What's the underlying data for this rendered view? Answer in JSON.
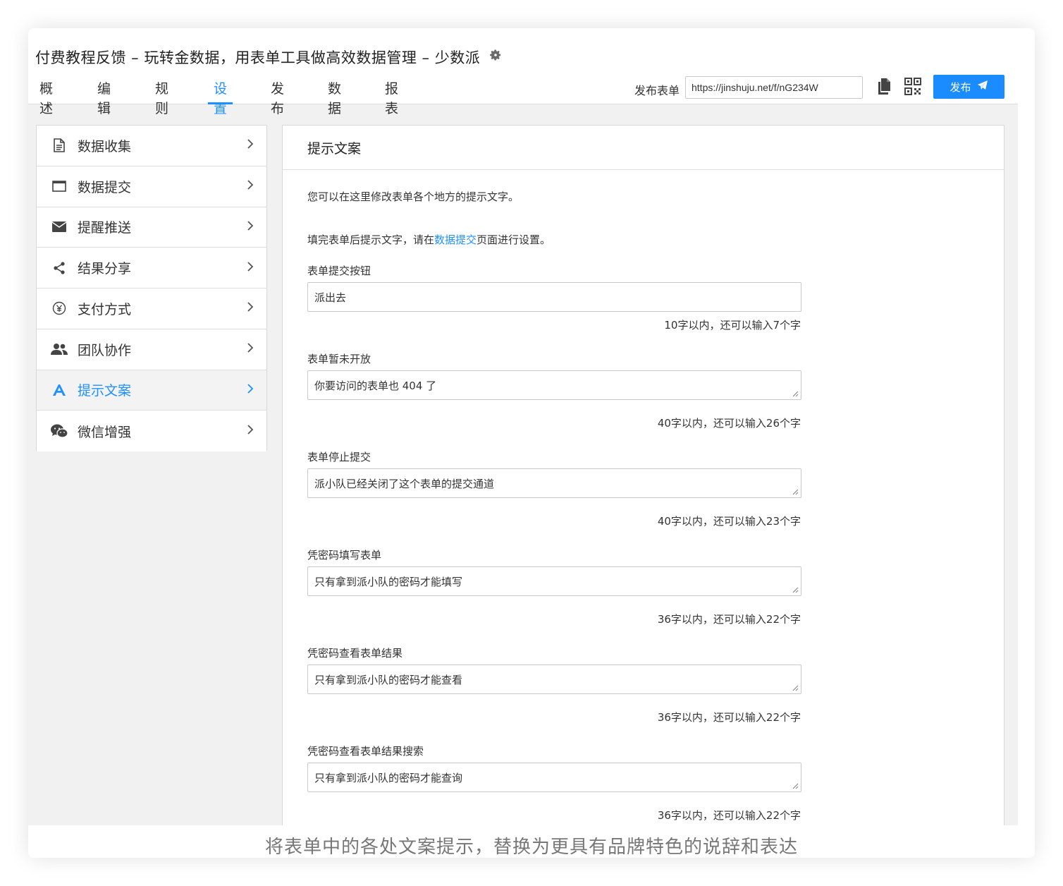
{
  "header": {
    "title": "付费教程反馈 – 玩转金数据，用表单工具做高效数据管理 – 少数派",
    "tabs": [
      "概述",
      "编辑",
      "规则",
      "设置",
      "发布",
      "数据",
      "报表"
    ],
    "active_tab": "设置",
    "publish_label": "发布表单",
    "publish_url": "https://jinshuju.net/f/nG234W",
    "publish_button": "发布"
  },
  "sidebar": {
    "items": [
      {
        "label": "数据收集",
        "icon": "document-icon"
      },
      {
        "label": "数据提交",
        "icon": "window-icon"
      },
      {
        "label": "提醒推送",
        "icon": "envelope-icon"
      },
      {
        "label": "结果分享",
        "icon": "share-icon"
      },
      {
        "label": "支付方式",
        "icon": "yen-icon"
      },
      {
        "label": "团队协作",
        "icon": "users-icon"
      },
      {
        "label": "提示文案",
        "icon": "font-icon"
      },
      {
        "label": "微信增强",
        "icon": "wechat-icon"
      }
    ],
    "active": "提示文案"
  },
  "panel": {
    "title": "提示文案",
    "intro": "您可以在这里修改表单各个地方的提示文字。",
    "note_before": "填完表单后提示文字，请在",
    "note_link": "数据提交",
    "note_after": "页面进行设置。",
    "fields": [
      {
        "label": "表单提交按钮",
        "value": "派出去",
        "counter": "10字以内，还可以输入7个字"
      },
      {
        "label": "表单暂未开放",
        "value": "你要访问的表单也 404 了",
        "counter": "40字以内，还可以输入26个字"
      },
      {
        "label": "表单停止提交",
        "value": "派小队已经关闭了这个表单的提交通道",
        "counter": "40字以内，还可以输入23个字"
      },
      {
        "label": "凭密码填写表单",
        "value": "只有拿到派小队的密码才能填写",
        "counter": "36字以内，还可以输入22个字"
      },
      {
        "label": "凭密码查看表单结果",
        "value": "只有拿到派小队的密码才能查看",
        "counter": "36字以内，还可以输入22个字"
      },
      {
        "label": "凭密码查看表单结果搜索",
        "value": "只有拿到派小队的密码才能查询",
        "counter": "36字以内，还可以输入22个字"
      }
    ]
  },
  "caption": "将表单中的各处文案提示，替换为更具有品牌特色的说辞和表达",
  "colors": {
    "accent": "#1e90ff",
    "button": "#1a8cff"
  }
}
